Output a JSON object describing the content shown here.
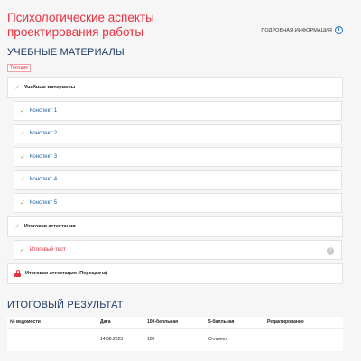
{
  "header": {
    "course_title": "Психологические аспекты проектирования работы",
    "details_label": "ПОДРОБНАЯ ИНФОРМАЦИЯ",
    "info_glyph": "i"
  },
  "materials": {
    "section_title": "УЧЕБНЫЕ МАТЕРИАЛЫ",
    "current_badge": "Текущие",
    "modules": [
      {
        "label": "Учебные материалы",
        "status": "completed"
      },
      {
        "label": "Конспект 1",
        "status": "completed"
      },
      {
        "label": "Конспект 2",
        "status": "completed"
      },
      {
        "label": "Конспект 3",
        "status": "completed"
      },
      {
        "label": "Конспект 4",
        "status": "completed"
      },
      {
        "label": "Конспект 5",
        "status": "completed"
      },
      {
        "label": "Итоговая аттестация",
        "status": "completed"
      },
      {
        "label": "Итоговый тест",
        "status": "completed",
        "active": true,
        "side_glyph": "?"
      },
      {
        "label": "Итоговая аттестация (Пересдача)",
        "status": "locked"
      }
    ],
    "check_glyph": "✓"
  },
  "results": {
    "section_title": "ИТОГОВЫЙ РЕЗУЛЬТАТ",
    "columns": [
      "№ ведомости",
      "Дата",
      "100-балльная",
      "5-балльная",
      "Редактирование"
    ],
    "rows": [
      [
        "",
        "14.08.2023",
        "100",
        "Отлично",
        ""
      ]
    ]
  },
  "colors": {
    "accent_red": "#e8303f",
    "check_green": "#7cb23a",
    "title_navy": "#1f3a64",
    "link_blue": "#1d5f9e"
  }
}
